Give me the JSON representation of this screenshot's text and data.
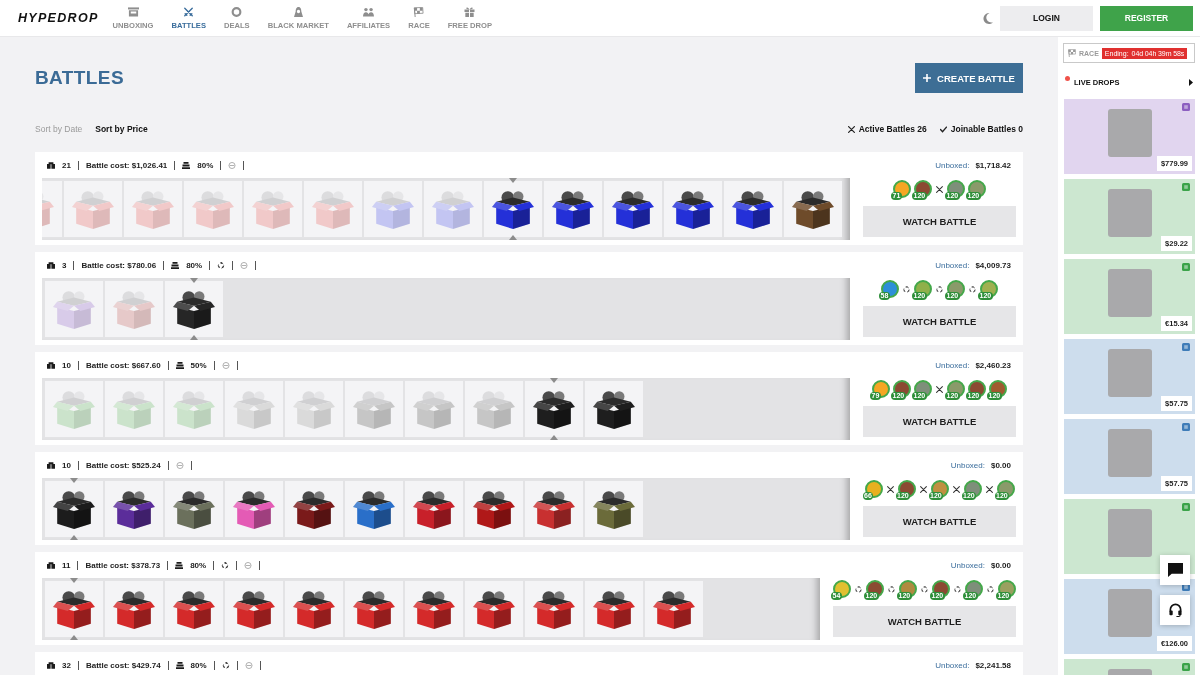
{
  "header": {
    "logo": "HYPEDROP",
    "nav": [
      {
        "label": "UNBOXING",
        "selected": false
      },
      {
        "label": "BATTLES",
        "selected": true
      },
      {
        "label": "DEALS",
        "selected": false
      },
      {
        "label": "BLACK MARKET",
        "selected": false
      },
      {
        "label": "AFFILIATES",
        "selected": false
      },
      {
        "label": "RACE",
        "selected": false
      },
      {
        "label": "FREE DROP",
        "selected": false
      }
    ],
    "login": "LOGIN",
    "register": "REGISTER"
  },
  "page": {
    "title": "BATTLES",
    "create_button": "CREATE BATTLE",
    "sort_options": [
      {
        "label": "Sort by Date",
        "selected": false
      },
      {
        "label": "Sort by Price",
        "selected": true
      }
    ],
    "filters": [
      {
        "kind": "active",
        "label": "Active Battles 26"
      },
      {
        "kind": "joinable",
        "label": "Joinable Battles 0"
      }
    ]
  },
  "battles": [
    {
      "box_count": "21",
      "cost": "Battle cost: $1,026.41",
      "percent": "80%",
      "cycle": false,
      "unboxed_label": "Unboxed:",
      "unboxed": "$1,718.42",
      "watch_button": "WATCH BATTLE",
      "boxes": [
        {
          "color": "#f1c9c9",
          "opened": true,
          "current": false
        },
        {
          "color": "#f1c9c9",
          "opened": true,
          "current": false
        },
        {
          "color": "#f1c9c9",
          "opened": true,
          "current": false
        },
        {
          "color": "#f1c9c9",
          "opened": true,
          "current": false
        },
        {
          "color": "#f1c9c9",
          "opened": true,
          "current": false
        },
        {
          "color": "#f1c9c9",
          "opened": true,
          "current": false
        },
        {
          "color": "#c3c5f2",
          "opened": true,
          "current": false
        },
        {
          "color": "#c3c5f2",
          "opened": true,
          "current": false
        },
        {
          "color": "#2430d8",
          "opened": false,
          "current": true
        },
        {
          "color": "#2430d8",
          "opened": false,
          "current": false
        },
        {
          "color": "#2430d8",
          "opened": false,
          "current": false
        },
        {
          "color": "#2430d8",
          "opened": false,
          "current": false
        },
        {
          "color": "#2430d8",
          "opened": false,
          "current": false
        },
        {
          "color": "#6e4b2a",
          "opened": false,
          "current": false
        }
      ],
      "teams": [
        [
          {
            "badge": "71",
            "color": "#f5a623"
          },
          {
            "badge": "120",
            "color": "#8b4a32"
          }
        ],
        [
          {
            "badge": "120",
            "color": "#7e8f7a"
          },
          {
            "badge": "120",
            "color": "#8a9a6a"
          }
        ]
      ]
    },
    {
      "box_count": "3",
      "cost": "Battle cost: $780.06",
      "percent": "80%",
      "cycle": true,
      "unboxed_label": "Unboxed:",
      "unboxed": "$4,009.73",
      "watch_button": "WATCH BATTLE",
      "boxes": [
        {
          "color": "#d8cbe9",
          "opened": true,
          "current": false
        },
        {
          "color": "#e6c9c9",
          "opened": true,
          "current": false
        },
        {
          "color": "#262626",
          "opened": false,
          "current": true
        }
      ],
      "teams": [
        [
          {
            "badge": "58",
            "color": "#2d8fd8"
          }
        ],
        [
          {
            "badge": "120",
            "color": "#8fb04a"
          }
        ],
        [
          {
            "badge": "120",
            "color": "#8a9a6a"
          }
        ],
        [
          {
            "badge": "120",
            "color": "#a0b050"
          }
        ]
      ]
    },
    {
      "box_count": "10",
      "cost": "Battle cost: $667.60",
      "percent": "50%",
      "cycle": false,
      "unboxed_label": "Unboxed:",
      "unboxed": "$2,460.23",
      "watch_button": "WATCH BATTLE",
      "boxes": [
        {
          "color": "#cbe3cb",
          "opened": true,
          "current": false
        },
        {
          "color": "#cbe3cb",
          "opened": true,
          "current": false
        },
        {
          "color": "#cbe3cb",
          "opened": true,
          "current": false
        },
        {
          "color": "#dadada",
          "opened": true,
          "current": false
        },
        {
          "color": "#dadada",
          "opened": true,
          "current": false
        },
        {
          "color": "#c6c6c6",
          "opened": true,
          "current": false
        },
        {
          "color": "#c6c6c6",
          "opened": true,
          "current": false
        },
        {
          "color": "#c6c6c6",
          "opened": true,
          "current": false
        },
        {
          "color": "#1e1e1e",
          "opened": false,
          "current": true
        },
        {
          "color": "#1e1e1e",
          "opened": false,
          "current": false
        }
      ],
      "teams": [
        [
          {
            "badge": "79",
            "color": "#f5a623"
          },
          {
            "badge": "120",
            "color": "#8b4a32"
          },
          {
            "badge": "120",
            "color": "#7e8f7a"
          }
        ],
        [
          {
            "badge": "120",
            "color": "#8a9a6a"
          },
          {
            "badge": "120",
            "color": "#8b4a32"
          },
          {
            "badge": "120",
            "color": "#a05a30"
          }
        ]
      ]
    },
    {
      "box_count": "10",
      "cost": "Battle cost: $525.24",
      "cycle": false,
      "unboxed_label": "Unboxed:",
      "unboxed": "$0.00",
      "watch_button": "WATCH BATTLE",
      "boxes": [
        {
          "color": "#1c1c1c",
          "opened": false,
          "current": true
        },
        {
          "color": "#5b2d9a",
          "opened": false,
          "current": false
        },
        {
          "color": "#6b705c",
          "opened": false,
          "current": false
        },
        {
          "color": "#e45bb5",
          "opened": false,
          "current": false
        },
        {
          "color": "#7a1a1a",
          "opened": false,
          "current": false
        },
        {
          "color": "#2a6fc9",
          "opened": false,
          "current": false
        },
        {
          "color": "#c8202a",
          "opened": false,
          "current": false
        },
        {
          "color": "#b01818",
          "opened": false,
          "current": false
        },
        {
          "color": "#c83030",
          "opened": false,
          "current": false
        },
        {
          "color": "#6b6b3a",
          "opened": false,
          "current": false
        }
      ],
      "teams": [
        [
          {
            "badge": "66",
            "color": "#e8b020"
          }
        ],
        [
          {
            "badge": "120",
            "color": "#8b4a32"
          }
        ],
        [
          {
            "badge": "120",
            "color": "#c09040"
          }
        ],
        [
          {
            "badge": "120",
            "color": "#7e8f7a"
          }
        ],
        [
          {
            "badge": "120",
            "color": "#8a9a6a"
          }
        ]
      ]
    },
    {
      "box_count": "11",
      "cost": "Battle cost: $378.73",
      "percent": "80%",
      "cycle": true,
      "unboxed_label": "Unboxed:",
      "unboxed": "$0.00",
      "watch_button": "WATCH BATTLE",
      "boxes": [
        {
          "color": "#d42a2a",
          "opened": false,
          "current": true
        },
        {
          "color": "#d42a2a",
          "opened": false,
          "current": false
        },
        {
          "color": "#d42a2a",
          "opened": false,
          "current": false
        },
        {
          "color": "#d42a2a",
          "opened": false,
          "current": false
        },
        {
          "color": "#d42a2a",
          "opened": false,
          "current": false
        },
        {
          "color": "#d42a2a",
          "opened": false,
          "current": false
        },
        {
          "color": "#d42a2a",
          "opened": false,
          "current": false
        },
        {
          "color": "#d42a2a",
          "opened": false,
          "current": false
        },
        {
          "color": "#d42a2a",
          "opened": false,
          "current": false
        },
        {
          "color": "#d42a2a",
          "opened": false,
          "current": false
        },
        {
          "color": "#d42a2a",
          "opened": false,
          "current": false
        }
      ],
      "teams": [
        [
          {
            "badge": "54",
            "color": "#e0c030"
          }
        ],
        [
          {
            "badge": "120",
            "color": "#8b4a32"
          }
        ],
        [
          {
            "badge": "120",
            "color": "#b08a40"
          }
        ],
        [
          {
            "badge": "120",
            "color": "#8b4a32"
          }
        ],
        [
          {
            "badge": "120",
            "color": "#7e8f7a"
          }
        ],
        [
          {
            "badge": "120",
            "color": "#9aa060"
          }
        ]
      ]
    },
    {
      "box_count": "32",
      "cost": "Battle cost: $429.74",
      "percent": "80%",
      "cycle": true,
      "unboxed_label": "Unboxed:",
      "unboxed": "$2,241.58"
    }
  ],
  "sidebar": {
    "race_label": "RACE",
    "timer_label": "Ending:",
    "timer": "04d 04h 39m 58s",
    "live_drops": "LIVE DROPS",
    "drops": [
      {
        "color": "#8c5fc0",
        "price": "$779.99"
      },
      {
        "color": "#3ba34a",
        "price": "$29.22"
      },
      {
        "color": "#3ba34a",
        "price": "€15.34"
      },
      {
        "color": "#3e7cb8",
        "price": "$57.75"
      },
      {
        "color": "#3e7cb8",
        "price": "$57.75"
      },
      {
        "color": "#3ba34a"
      },
      {
        "color": "#3e7cb8",
        "price": "€126.00"
      },
      {
        "color": "#3ba34a"
      }
    ]
  }
}
